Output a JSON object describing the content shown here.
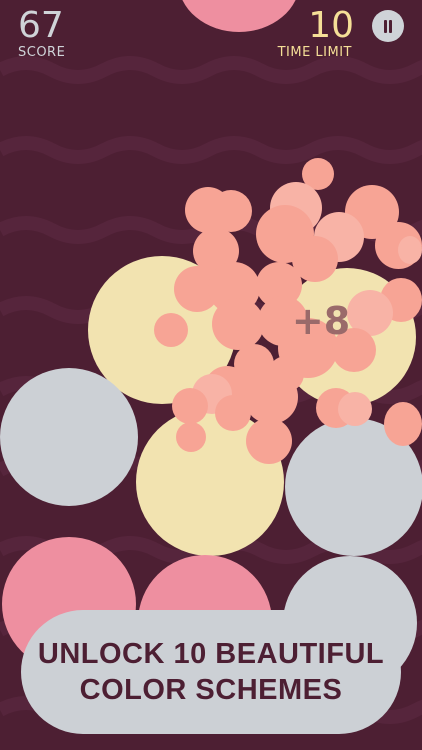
{
  "hud": {
    "score_value": "67",
    "score_label": "SCORE",
    "time_value": "10",
    "time_label": "TIME LIMIT"
  },
  "combo": {
    "text": "+8"
  },
  "banner": {
    "line1": "UNLOCK 10 BEAUTIFUL",
    "line2": "COLOR SCHEMES"
  },
  "colors": {
    "background": "#4d1f33",
    "wave": "#54243a",
    "yellow": "#f2e3b0",
    "gray": "#ccd0d5",
    "pink": "#ee8fa0",
    "salmon": "#f7a495",
    "salmon_light": "#f8b3a6"
  },
  "icons": {
    "pause": "pause-icon"
  }
}
